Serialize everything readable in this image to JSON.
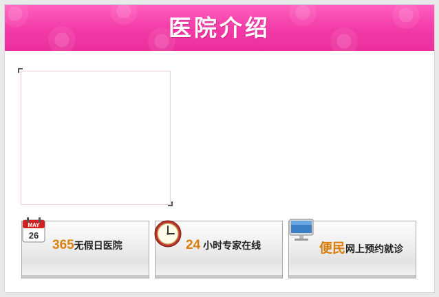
{
  "header": {
    "title": "医院介绍"
  },
  "features": [
    {
      "highlight": "365",
      "text": "无假日医院",
      "icon": "calendar-icon",
      "calendar_month": "MAY",
      "calendar_day": "26"
    },
    {
      "highlight": "24",
      "text": "小时专家在线",
      "icon": "clock-icon"
    },
    {
      "highlight": "便民",
      "text": "网上预约就诊",
      "icon": "computer-icon"
    }
  ],
  "colors": {
    "header": "#f23aa6",
    "highlight": "#d97f0a",
    "text": "#222222"
  }
}
